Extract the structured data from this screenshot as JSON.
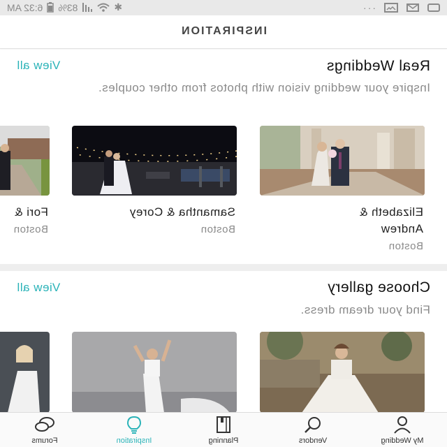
{
  "status_bar": {
    "time": "6:32 AM",
    "battery": "83%"
  },
  "header": {
    "title": "INSPIRATION"
  },
  "real_weddings": {
    "title": "Real Weddings",
    "description": "Inspire your wedding vision with photos from other couples.",
    "view_all": "View all",
    "cards": [
      {
        "name": "Elizabeth & Andrew",
        "location": "Boston"
      },
      {
        "name": "Samantha & Corey",
        "location": "Boston"
      },
      {
        "name": "Fori &",
        "location": "Boston"
      }
    ]
  },
  "gallery": {
    "title": "Choose gallery",
    "description": "Find your dream dress.",
    "view_all": "View all"
  },
  "bottom_nav": {
    "items": [
      {
        "label": "My Wedding",
        "icon": "person-icon"
      },
      {
        "label": "Vendors",
        "icon": "search-icon"
      },
      {
        "label": "Planning",
        "icon": "notebook-icon"
      },
      {
        "label": "Inspiration",
        "icon": "lightbulb-icon"
      },
      {
        "label": "Forums",
        "icon": "chat-bubbles-icon"
      }
    ]
  },
  "colors": {
    "accent": "#2ab3b8",
    "muted": "#8a8a8a",
    "divider": "#eeeeee"
  }
}
